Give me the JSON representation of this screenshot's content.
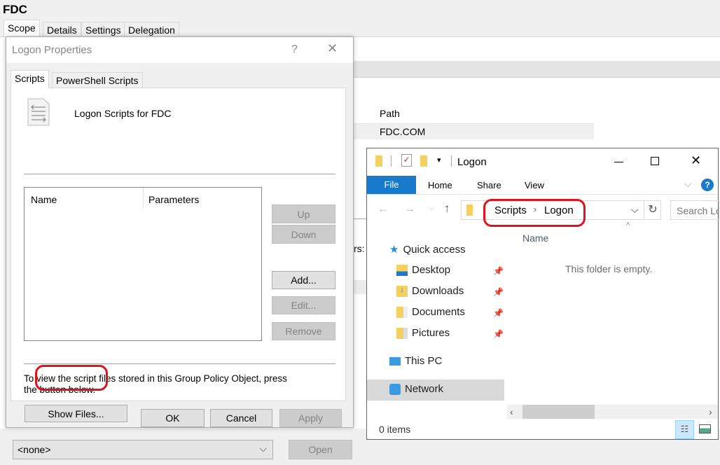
{
  "gpmc": {
    "title": "FDC",
    "tabs": [
      "Scope",
      "Details",
      "Settings",
      "Delegation"
    ],
    "path_header": "Path",
    "path_value": "FDC.COM",
    "partial_label": "rs:",
    "wmi_select": "<none>",
    "open_label": "Open"
  },
  "dialog": {
    "title": "Logon Properties",
    "help": "?",
    "close": "✕",
    "tabs": [
      "Scripts",
      "PowerShell Scripts"
    ],
    "heading": "Logon Scripts for FDC",
    "columns": [
      "Name",
      "Parameters"
    ],
    "buttons": {
      "up": "Up",
      "down": "Down",
      "add": "Add...",
      "edit": "Edit...",
      "remove": "Remove",
      "show_files": "Show Files...",
      "ok": "OK",
      "cancel": "Cancel",
      "apply": "Apply"
    },
    "info": "To view the script files stored in this Group Policy Object, press the button below."
  },
  "explorer": {
    "title": "Logon",
    "ribbon": [
      "File",
      "Home",
      "Share",
      "View"
    ],
    "breadcrumb": [
      "Scripts",
      "Logon"
    ],
    "search_placeholder": "Search Lo",
    "column": "Name",
    "empty": "This folder is empty.",
    "status": "0 items",
    "nav": {
      "quick_access": "Quick access",
      "items": [
        "Desktop",
        "Downloads",
        "Documents",
        "Pictures"
      ],
      "this_pc": "This PC",
      "network": "Network"
    },
    "accent": "#1979ca"
  },
  "highlight_color": "#e0121c"
}
